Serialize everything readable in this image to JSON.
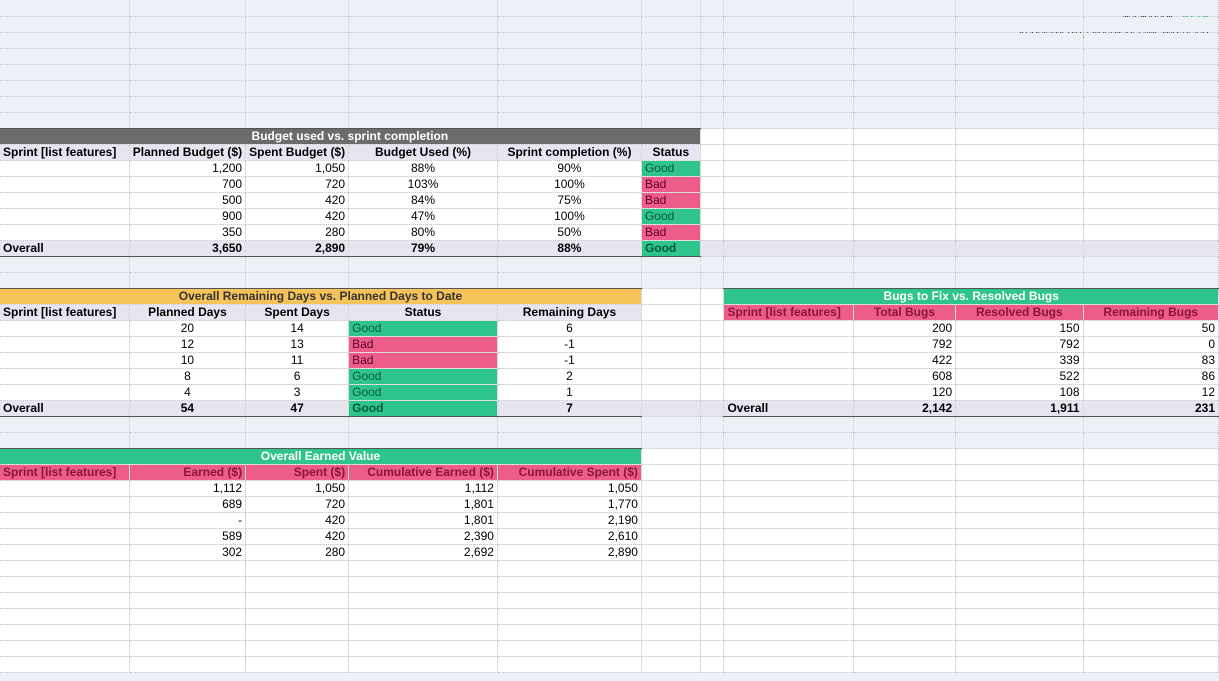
{
  "logo": {
    "brand": "status",
    "badge": "net",
    "tagline": "Automate your reporting with status.net"
  },
  "budget": {
    "title": "Budget used vs. sprint completion",
    "headers": [
      "Sprint [list features]",
      "Planned Budget ($)",
      "Spent Budget ($)",
      "Budget Used (%)",
      "Sprint completion (%)",
      "Status"
    ],
    "rows": [
      {
        "sprint": "",
        "planned": "1,200",
        "spent": "1,050",
        "used": "88%",
        "comp": "90%",
        "status": "Good",
        "cls": "good"
      },
      {
        "sprint": "",
        "planned": "700",
        "spent": "720",
        "used": "103%",
        "comp": "100%",
        "status": "Bad",
        "cls": "bad"
      },
      {
        "sprint": "",
        "planned": "500",
        "spent": "420",
        "used": "84%",
        "comp": "75%",
        "status": "Bad",
        "cls": "bad"
      },
      {
        "sprint": "",
        "planned": "900",
        "spent": "420",
        "used": "47%",
        "comp": "100%",
        "status": "Good",
        "cls": "good"
      },
      {
        "sprint": "",
        "planned": "350",
        "spent": "280",
        "used": "80%",
        "comp": "50%",
        "status": "Bad",
        "cls": "bad"
      }
    ],
    "overall": {
      "label": "Overall",
      "planned": "3,650",
      "spent": "2,890",
      "used": "79%",
      "comp": "88%",
      "status": "Good"
    }
  },
  "remaining": {
    "title": "Overall Remaining Days vs. Planned Days to Date",
    "headers": [
      "Sprint [list features]",
      "Planned Days",
      "Spent Days",
      "Status",
      "Remaining Days"
    ],
    "rows": [
      {
        "sprint": "",
        "planned": "20",
        "spent": "14",
        "status": "Good",
        "cls": "good",
        "rem": "6"
      },
      {
        "sprint": "",
        "planned": "12",
        "spent": "13",
        "status": "Bad",
        "cls": "bad",
        "rem": "-1"
      },
      {
        "sprint": "",
        "planned": "10",
        "spent": "11",
        "status": "Bad",
        "cls": "bad",
        "rem": "-1"
      },
      {
        "sprint": "",
        "planned": "8",
        "spent": "6",
        "status": "Good",
        "cls": "good",
        "rem": "2"
      },
      {
        "sprint": "",
        "planned": "4",
        "spent": "3",
        "status": "Good",
        "cls": "good",
        "rem": "1"
      }
    ],
    "overall": {
      "label": "Overall",
      "planned": "54",
      "spent": "47",
      "status": "Good",
      "rem": "7"
    }
  },
  "bugs": {
    "title": "Bugs to Fix vs. Resolved Bugs",
    "headers": [
      "Sprint [list features]",
      "Total Bugs",
      "Resolved Bugs",
      "Remaining Bugs"
    ],
    "rows": [
      {
        "sprint": "",
        "total": "200",
        "resolved": "150",
        "rem": "50"
      },
      {
        "sprint": "",
        "total": "792",
        "resolved": "792",
        "rem": "0"
      },
      {
        "sprint": "",
        "total": "422",
        "resolved": "339",
        "rem": "83"
      },
      {
        "sprint": "",
        "total": "608",
        "resolved": "522",
        "rem": "86"
      },
      {
        "sprint": "",
        "total": "120",
        "resolved": "108",
        "rem": "12"
      }
    ],
    "overall": {
      "label": "Overall",
      "total": "2,142",
      "resolved": "1,911",
      "rem": "231"
    }
  },
  "earned": {
    "title": "Overall Earned Value",
    "headers": [
      "Sprint [list features]",
      "Earned ($)",
      "Spent ($)",
      "Cumulative Earned ($)",
      "Cumulative Spent ($)"
    ],
    "rows": [
      {
        "sprint": "",
        "earned": "1,112",
        "spent": "1,050",
        "cearn": "1,112",
        "cspent": "1,050"
      },
      {
        "sprint": "",
        "earned": "689",
        "spent": "720",
        "cearn": "1,801",
        "cspent": "1,770"
      },
      {
        "sprint": "",
        "earned": "-",
        "spent": "420",
        "cearn": "1,801",
        "cspent": "2,190"
      },
      {
        "sprint": "",
        "earned": "589",
        "spent": "420",
        "cearn": "2,390",
        "cspent": "2,610"
      },
      {
        "sprint": "",
        "earned": "302",
        "spent": "280",
        "cearn": "2,692",
        "cspent": "2,890"
      }
    ]
  },
  "cols": [
    130,
    105,
    100,
    150,
    145,
    60,
    25,
    130,
    105,
    130,
    138
  ]
}
